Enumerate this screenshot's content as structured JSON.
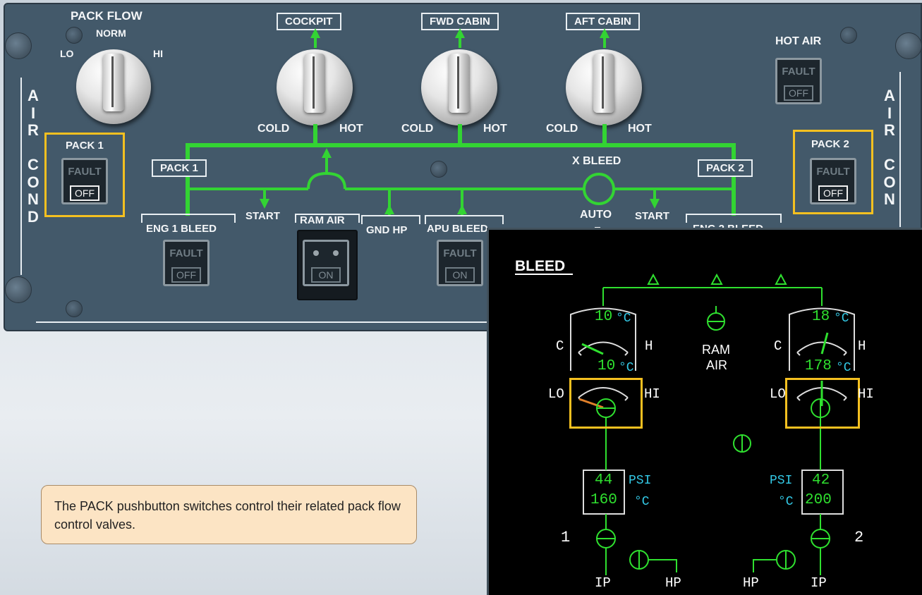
{
  "panel": {
    "side_label_left": [
      "A",
      "I",
      "R",
      "",
      "C",
      "O",
      "N",
      "D"
    ],
    "side_label_right": [
      "A",
      "I",
      "R",
      "",
      "C",
      "O",
      "N"
    ],
    "pack_flow": {
      "title": "PACK FLOW",
      "lo": "LO",
      "norm": "NORM",
      "hi": "HI"
    },
    "temp_zones": [
      {
        "title": "COCKPIT",
        "cold": "COLD",
        "hot": "HOT"
      },
      {
        "title": "FWD CABIN",
        "cold": "COLD",
        "hot": "HOT"
      },
      {
        "title": "AFT CABIN",
        "cold": "COLD",
        "hot": "HOT"
      }
    ],
    "hot_air": {
      "title": "HOT AIR",
      "fault": "FAULT",
      "state": "OFF"
    },
    "pack1_pb": {
      "title": "PACK 1",
      "fault": "FAULT",
      "state": "OFF"
    },
    "pack2_pb": {
      "title": "PACK 2",
      "fault": "FAULT",
      "state": "OFF"
    },
    "pack1_label": "PACK 1",
    "pack2_label": "PACK 2",
    "x_bleed": "X BLEED",
    "x_bleed_mode": "AUTO",
    "start_left": "START",
    "start_right": "START",
    "eng1_bleed": {
      "title": "ENG 1 BLEED",
      "fault": "FAULT",
      "state": "OFF"
    },
    "ram_air": {
      "title": "RAM AIR",
      "state": "ON"
    },
    "gnd_hp": "GND HP",
    "apu_bleed": {
      "title": "APU BLEED",
      "fault": "FAULT",
      "state": "ON"
    },
    "eng2_bleed_partial": "ENG 2 BLEED"
  },
  "ecam": {
    "title": "BLEED",
    "ram_air": [
      "RAM",
      "AIR"
    ],
    "left": {
      "outlet_temp": "10",
      "outlet_unit": "°C",
      "comp_temp": "10",
      "comp_unit": "°C",
      "c": "C",
      "h": "H",
      "lo": "LO",
      "hi": "HI",
      "psi": "44",
      "psi_unit": "PSI",
      "bleed_temp": "160",
      "temp_unit": "°C",
      "engine": "1",
      "ip": "IP",
      "hp": "HP"
    },
    "right": {
      "outlet_temp": "18",
      "outlet_unit": "°C",
      "comp_temp": "178",
      "comp_unit": "°C",
      "c": "C",
      "h": "H",
      "lo": "LO",
      "hi": "HI",
      "psi": "42",
      "psi_unit": "PSI",
      "bleed_temp": "200",
      "temp_unit": "°C",
      "engine": "2",
      "ip": "IP",
      "hp": "HP"
    }
  },
  "note": {
    "text": "The PACK pushbutton switches control their related pack flow control valves."
  },
  "colors": {
    "panel": "#43596a",
    "ecam_green": "#2fe02f",
    "ecam_cyan": "#33c9e6",
    "highlight": "#f5c020",
    "duct_green": "#33d433"
  }
}
